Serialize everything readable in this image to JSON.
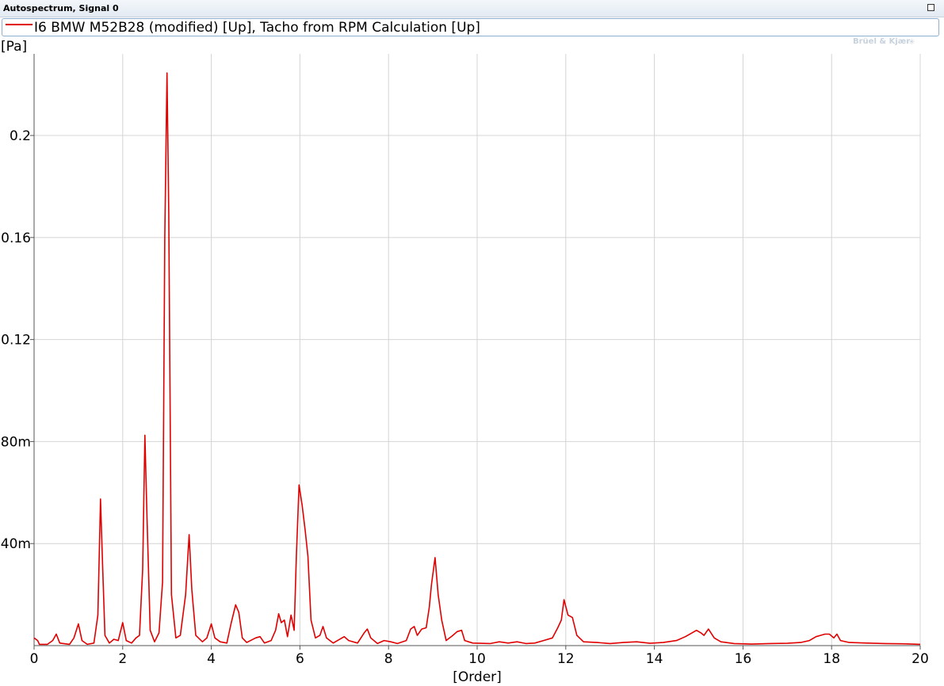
{
  "window": {
    "title": "Autospectrum, Signal 0"
  },
  "legend": {
    "label": "I6 BMW M52B28 (modified) [Up], Tacho from RPM Calculation [Up]",
    "color": "#e00000"
  },
  "brand": {
    "text": "Brüel & Kjær",
    "mark": "✳"
  },
  "chart_data": {
    "type": "line",
    "title": "",
    "xlabel": "[Order]",
    "ylabel": "[Pa]",
    "xlim": [
      0,
      20
    ],
    "ylim": [
      0,
      0.232
    ],
    "grid": true,
    "x_ticks": [
      {
        "value": 0,
        "label": "0"
      },
      {
        "value": 2,
        "label": "2"
      },
      {
        "value": 4,
        "label": "4"
      },
      {
        "value": 6,
        "label": "6"
      },
      {
        "value": 8,
        "label": "8"
      },
      {
        "value": 10,
        "label": "10"
      },
      {
        "value": 12,
        "label": "12"
      },
      {
        "value": 14,
        "label": "14"
      },
      {
        "value": 16,
        "label": "16"
      },
      {
        "value": 18,
        "label": "18"
      },
      {
        "value": 20,
        "label": "20"
      }
    ],
    "y_ticks": [
      {
        "value": 0.04,
        "label": "40m"
      },
      {
        "value": 0.08,
        "label": "80m"
      },
      {
        "value": 0.12,
        "label": "0.12"
      },
      {
        "value": 0.16,
        "label": "0.16"
      },
      {
        "value": 0.2,
        "label": "0.2"
      }
    ],
    "series": [
      {
        "name": "I6 BMW M52B28 (modified) [Up], Tacho from RPM Calculation [Up]",
        "color": "#e00000",
        "points": [
          [
            0.0,
            0.003
          ],
          [
            0.08,
            0.002
          ],
          [
            0.12,
            0.0005
          ],
          [
            0.3,
            0.0005
          ],
          [
            0.42,
            0.002
          ],
          [
            0.5,
            0.0045
          ],
          [
            0.58,
            0.001
          ],
          [
            0.8,
            0.0005
          ],
          [
            0.9,
            0.003
          ],
          [
            1.0,
            0.0085
          ],
          [
            1.08,
            0.002
          ],
          [
            1.2,
            0.0005
          ],
          [
            1.35,
            0.001
          ],
          [
            1.44,
            0.012
          ],
          [
            1.5,
            0.0575
          ],
          [
            1.55,
            0.03
          ],
          [
            1.6,
            0.004
          ],
          [
            1.7,
            0.001
          ],
          [
            1.8,
            0.0025
          ],
          [
            1.9,
            0.002
          ],
          [
            2.0,
            0.009
          ],
          [
            2.08,
            0.002
          ],
          [
            2.2,
            0.001
          ],
          [
            2.3,
            0.003
          ],
          [
            2.38,
            0.004
          ],
          [
            2.45,
            0.03
          ],
          [
            2.5,
            0.0825
          ],
          [
            2.55,
            0.05
          ],
          [
            2.62,
            0.006
          ],
          [
            2.72,
            0.0015
          ],
          [
            2.82,
            0.005
          ],
          [
            2.9,
            0.025
          ],
          [
            2.95,
            0.16
          ],
          [
            3.0,
            0.2245
          ],
          [
            3.04,
            0.17
          ],
          [
            3.1,
            0.02
          ],
          [
            3.2,
            0.003
          ],
          [
            3.3,
            0.004
          ],
          [
            3.42,
            0.02
          ],
          [
            3.5,
            0.0435
          ],
          [
            3.56,
            0.022
          ],
          [
            3.65,
            0.004
          ],
          [
            3.8,
            0.0015
          ],
          [
            3.9,
            0.003
          ],
          [
            4.0,
            0.0085
          ],
          [
            4.08,
            0.003
          ],
          [
            4.2,
            0.0015
          ],
          [
            4.35,
            0.001
          ],
          [
            4.45,
            0.009
          ],
          [
            4.55,
            0.016
          ],
          [
            4.62,
            0.013
          ],
          [
            4.7,
            0.003
          ],
          [
            4.8,
            0.0012
          ],
          [
            5.0,
            0.003
          ],
          [
            5.1,
            0.0035
          ],
          [
            5.2,
            0.001
          ],
          [
            5.35,
            0.002
          ],
          [
            5.45,
            0.006
          ],
          [
            5.52,
            0.0125
          ],
          [
            5.58,
            0.009
          ],
          [
            5.65,
            0.01
          ],
          [
            5.72,
            0.0035
          ],
          [
            5.8,
            0.012
          ],
          [
            5.87,
            0.006
          ],
          [
            5.92,
            0.035
          ],
          [
            5.98,
            0.063
          ],
          [
            6.05,
            0.055
          ],
          [
            6.12,
            0.045
          ],
          [
            6.18,
            0.035
          ],
          [
            6.25,
            0.01
          ],
          [
            6.35,
            0.003
          ],
          [
            6.45,
            0.004
          ],
          [
            6.52,
            0.0075
          ],
          [
            6.6,
            0.003
          ],
          [
            6.75,
            0.001
          ],
          [
            7.0,
            0.0035
          ],
          [
            7.1,
            0.002
          ],
          [
            7.3,
            0.001
          ],
          [
            7.45,
            0.005
          ],
          [
            7.52,
            0.0065
          ],
          [
            7.6,
            0.003
          ],
          [
            7.75,
            0.0008
          ],
          [
            7.9,
            0.002
          ],
          [
            8.05,
            0.0015
          ],
          [
            8.2,
            0.0008
          ],
          [
            8.4,
            0.002
          ],
          [
            8.5,
            0.0065
          ],
          [
            8.58,
            0.0075
          ],
          [
            8.65,
            0.004
          ],
          [
            8.75,
            0.0065
          ],
          [
            8.85,
            0.007
          ],
          [
            8.92,
            0.015
          ],
          [
            8.97,
            0.024
          ],
          [
            9.05,
            0.0345
          ],
          [
            9.12,
            0.02
          ],
          [
            9.2,
            0.01
          ],
          [
            9.3,
            0.002
          ],
          [
            9.45,
            0.004
          ],
          [
            9.55,
            0.0055
          ],
          [
            9.65,
            0.006
          ],
          [
            9.72,
            0.002
          ],
          [
            9.9,
            0.001
          ],
          [
            10.3,
            0.0008
          ],
          [
            10.5,
            0.0015
          ],
          [
            10.7,
            0.001
          ],
          [
            10.9,
            0.0015
          ],
          [
            11.1,
            0.0008
          ],
          [
            11.3,
            0.001
          ],
          [
            11.5,
            0.002
          ],
          [
            11.7,
            0.003
          ],
          [
            11.82,
            0.007
          ],
          [
            11.9,
            0.01
          ],
          [
            11.96,
            0.018
          ],
          [
            12.05,
            0.012
          ],
          [
            12.15,
            0.011
          ],
          [
            12.25,
            0.004
          ],
          [
            12.4,
            0.0015
          ],
          [
            12.7,
            0.0012
          ],
          [
            13.0,
            0.0008
          ],
          [
            13.3,
            0.0012
          ],
          [
            13.6,
            0.0015
          ],
          [
            13.9,
            0.0009
          ],
          [
            14.2,
            0.0012
          ],
          [
            14.5,
            0.002
          ],
          [
            14.7,
            0.0035
          ],
          [
            14.85,
            0.005
          ],
          [
            14.95,
            0.006
          ],
          [
            15.05,
            0.005
          ],
          [
            15.12,
            0.004
          ],
          [
            15.22,
            0.0065
          ],
          [
            15.35,
            0.003
          ],
          [
            15.5,
            0.0015
          ],
          [
            15.8,
            0.0008
          ],
          [
            16.2,
            0.0006
          ],
          [
            16.6,
            0.0008
          ],
          [
            17.0,
            0.0009
          ],
          [
            17.3,
            0.0012
          ],
          [
            17.5,
            0.002
          ],
          [
            17.65,
            0.0035
          ],
          [
            17.75,
            0.004
          ],
          [
            17.85,
            0.0045
          ],
          [
            17.95,
            0.0045
          ],
          [
            18.05,
            0.003
          ],
          [
            18.12,
            0.0045
          ],
          [
            18.2,
            0.002
          ],
          [
            18.4,
            0.0012
          ],
          [
            18.8,
            0.001
          ],
          [
            19.2,
            0.0008
          ],
          [
            19.6,
            0.0007
          ],
          [
            20.0,
            0.0005
          ]
        ]
      }
    ]
  }
}
